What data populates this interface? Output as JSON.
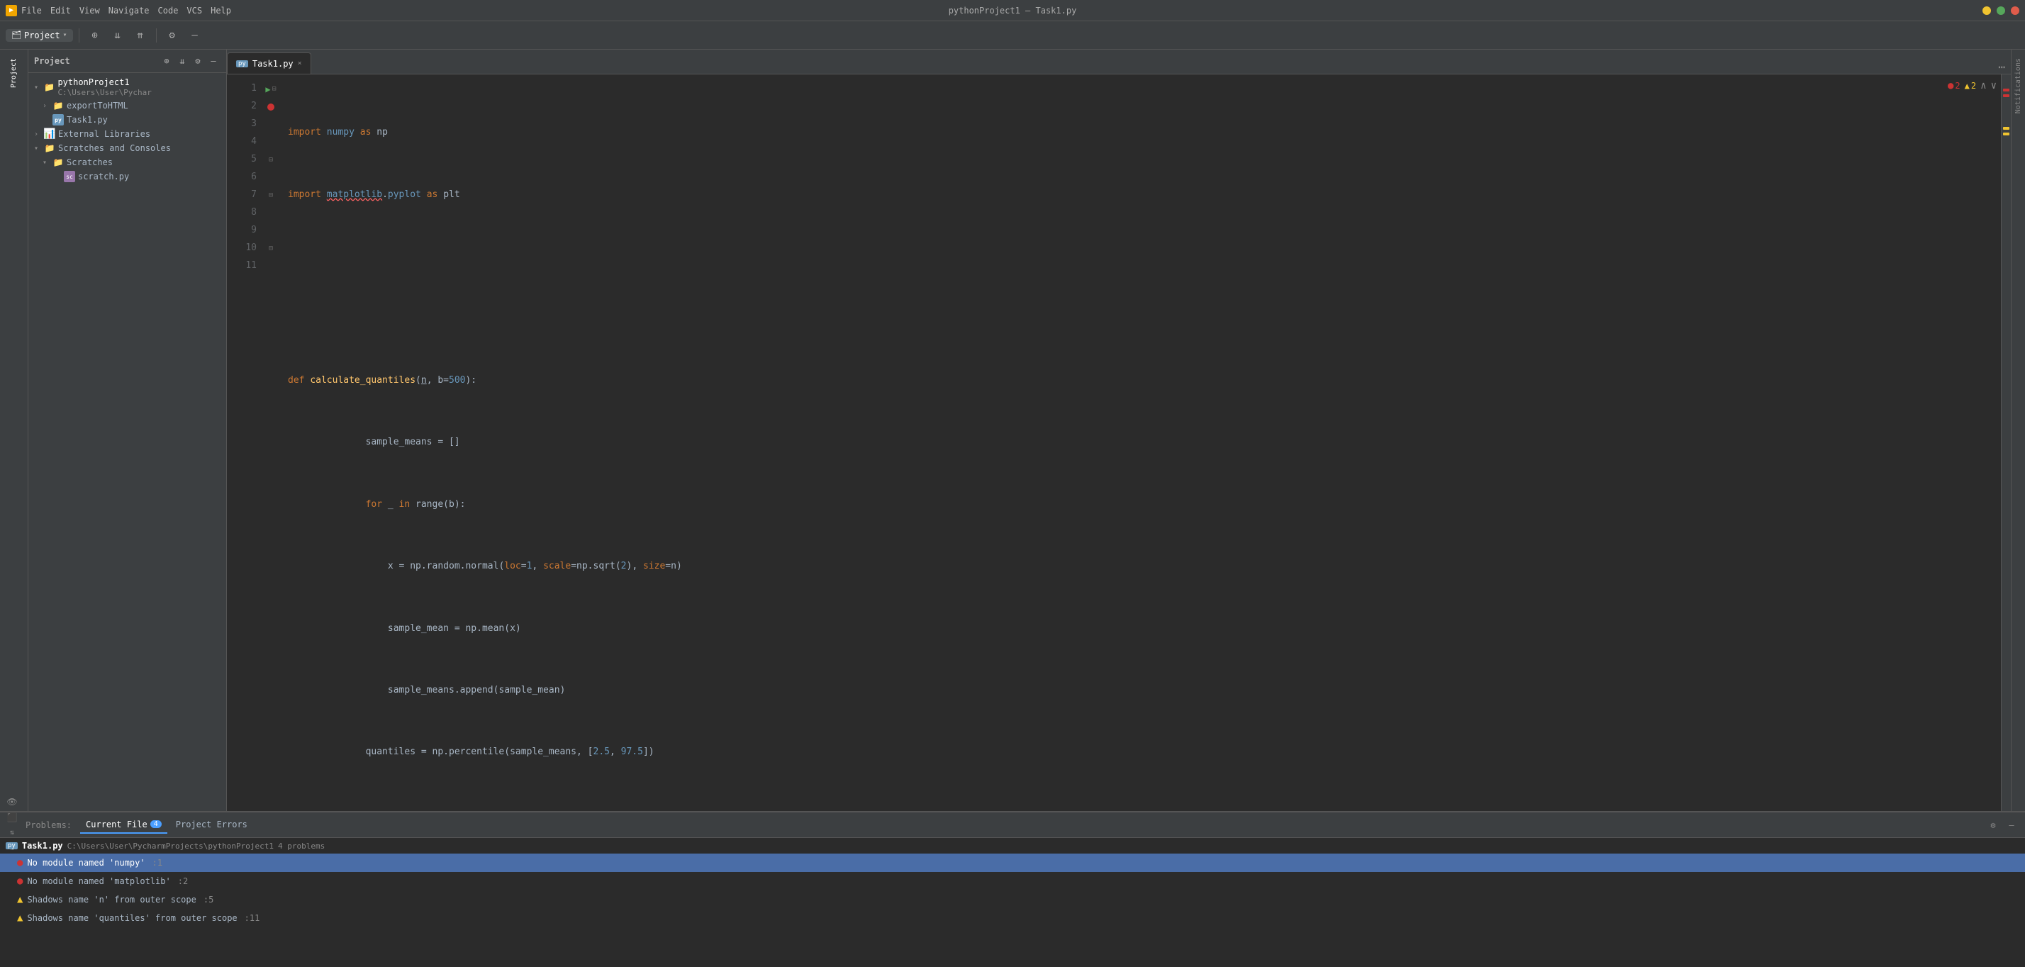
{
  "titleBar": {
    "icon": "▶",
    "menus": [
      "File",
      "Edit",
      "View",
      "Navigate",
      "Code",
      "VCS",
      "Help"
    ],
    "title": "pythonProject1 – Task1.py",
    "controls": [
      "minimize",
      "maximize",
      "close"
    ]
  },
  "toolbar": {
    "projectLabel": "Project",
    "buttons": [
      "+",
      "↕",
      "⇅",
      "⚙",
      "−"
    ]
  },
  "sidebar": {
    "title": "Project",
    "rootItem": "pythonProject1",
    "rootPath": "C:\\Users\\User\\Pychar",
    "items": [
      {
        "label": "exportToHTML",
        "type": "folder",
        "indent": 2,
        "expanded": false
      },
      {
        "label": "Task1.py",
        "type": "py",
        "indent": 2
      },
      {
        "label": "External Libraries",
        "type": "folder",
        "indent": 1,
        "expanded": false
      },
      {
        "label": "Scratches and Consoles",
        "type": "folder",
        "indent": 1,
        "expanded": true
      },
      {
        "label": "Scratches",
        "type": "folder",
        "indent": 2,
        "expanded": true
      },
      {
        "label": "scratch.py",
        "type": "scratch",
        "indent": 3
      }
    ]
  },
  "editor": {
    "tab": {
      "label": "Task1.py",
      "icon": "py"
    },
    "errorCount": "2",
    "warningCount": "2",
    "lines": [
      {
        "num": 1,
        "content": "import numpy as np",
        "hasRunArrow": true,
        "hasFold": true
      },
      {
        "num": 2,
        "content": "import matplotlib.pyplot as plt",
        "hasError": true
      },
      {
        "num": 3,
        "content": ""
      },
      {
        "num": 4,
        "content": ""
      },
      {
        "num": 5,
        "content": "def calculate_quantiles(n, b=500):",
        "hasFold": true
      },
      {
        "num": 6,
        "content": "    sample_means = []"
      },
      {
        "num": 7,
        "content": "    for _ in range(b):",
        "hasFold": true
      },
      {
        "num": 8,
        "content": "        x = np.random.normal(loc=1, scale=np.sqrt(2), size=n)"
      },
      {
        "num": 9,
        "content": "        sample_mean = np.mean(x)"
      },
      {
        "num": 10,
        "content": "        sample_means.append(sample_mean)",
        "hasFold": true
      },
      {
        "num": 11,
        "content": "    quantiles = np.percentile(sample_means, [2.5, 97.5])"
      }
    ]
  },
  "bottomPanel": {
    "label": "Problems:",
    "tabs": [
      {
        "label": "Current File",
        "count": "4",
        "active": true
      },
      {
        "label": "Project Errors",
        "count": null,
        "active": false
      }
    ],
    "fileEntry": {
      "filename": "Task1.py",
      "path": "C:\\Users\\User\\PycharmProjects\\pythonProject1",
      "problemCount": "4 problems"
    },
    "problems": [
      {
        "type": "error",
        "message": "No module named 'numpy'",
        "line": ":1",
        "selected": true
      },
      {
        "type": "error",
        "message": "No module named 'matplotlib'",
        "line": ":2",
        "selected": false
      },
      {
        "type": "warning",
        "message": "Shadows name 'n' from outer scope",
        "line": ":5",
        "selected": false
      },
      {
        "type": "warning",
        "message": "Shadows name 'quantiles' from outer scope",
        "line": ":11",
        "selected": false
      }
    ]
  },
  "icons": {
    "folder": "📁",
    "py": "py",
    "scratch": "🗒",
    "run": "▶",
    "error": "●",
    "warning": "▲",
    "gear": "⚙",
    "close": "×",
    "chevronRight": "›",
    "chevronDown": "⌄",
    "arrowUp": "∧",
    "arrowDown": "∨"
  }
}
